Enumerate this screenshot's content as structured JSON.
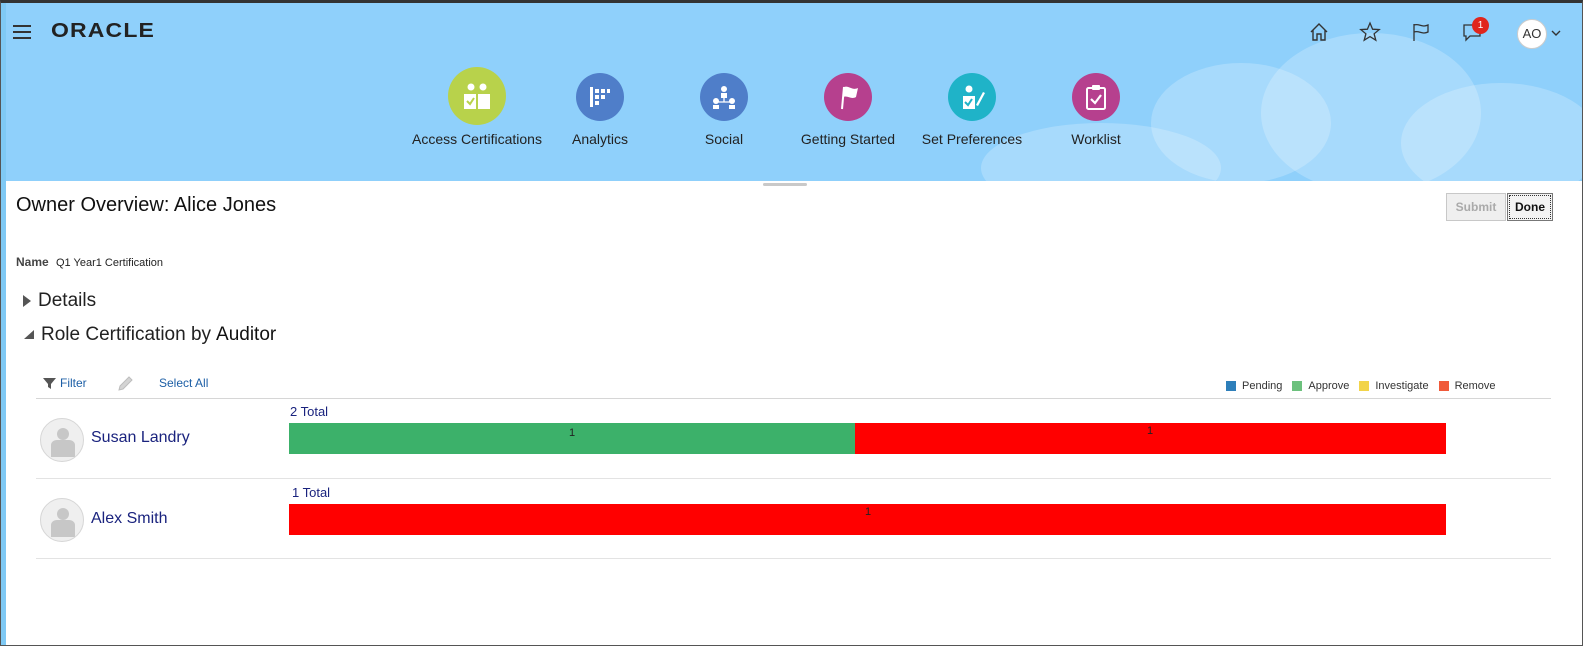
{
  "brand": {
    "name": "ORACLE"
  },
  "top_icons": [
    {
      "name": "home-icon"
    },
    {
      "name": "star-icon"
    },
    {
      "name": "flag-icon"
    },
    {
      "name": "notifications-icon",
      "badge": "1"
    }
  ],
  "user": {
    "initials": "AO"
  },
  "nav": [
    {
      "label": "Access Certifications",
      "color": "#b8d24b",
      "active": true
    },
    {
      "label": "Analytics",
      "color": "#4f7ec9"
    },
    {
      "label": "Social",
      "color": "#4f7ec9"
    },
    {
      "label": "Getting Started",
      "color": "#b6408e"
    },
    {
      "label": "Set Preferences",
      "color": "#1fb3c8"
    },
    {
      "label": "Worklist",
      "color": "#b6408e"
    }
  ],
  "page": {
    "title": "Owner Overview: Alice Jones",
    "submit_label": "Submit",
    "done_label": "Done",
    "name_label": "Name",
    "name_value": "Q1 Year1 Certification"
  },
  "sections": {
    "details": "Details",
    "role_cert_prefix": "Role Certification by",
    "role_cert_suffix": "Auditor"
  },
  "toolbar": {
    "filter_label": "Filter",
    "select_all_label": "Select All"
  },
  "legend": [
    {
      "label": "Pending",
      "color": "#2e7fba"
    },
    {
      "label": "Approve",
      "color": "#6cc17d"
    },
    {
      "label": "Investigate",
      "color": "#f2d44a"
    },
    {
      "label": "Remove",
      "color": "#f05a3a"
    }
  ],
  "bar_colors": {
    "approve": "#3cb16a",
    "remove": "#ff0000"
  },
  "rows": [
    {
      "name": "Susan Landry",
      "total": "2 Total",
      "segments": [
        {
          "status": "Approve",
          "count": "1"
        },
        {
          "status": "Remove",
          "count": "1"
        }
      ]
    },
    {
      "name": "Alex Smith",
      "total": "1 Total",
      "segments": [
        {
          "status": "Remove",
          "count": "1"
        }
      ]
    }
  ]
}
